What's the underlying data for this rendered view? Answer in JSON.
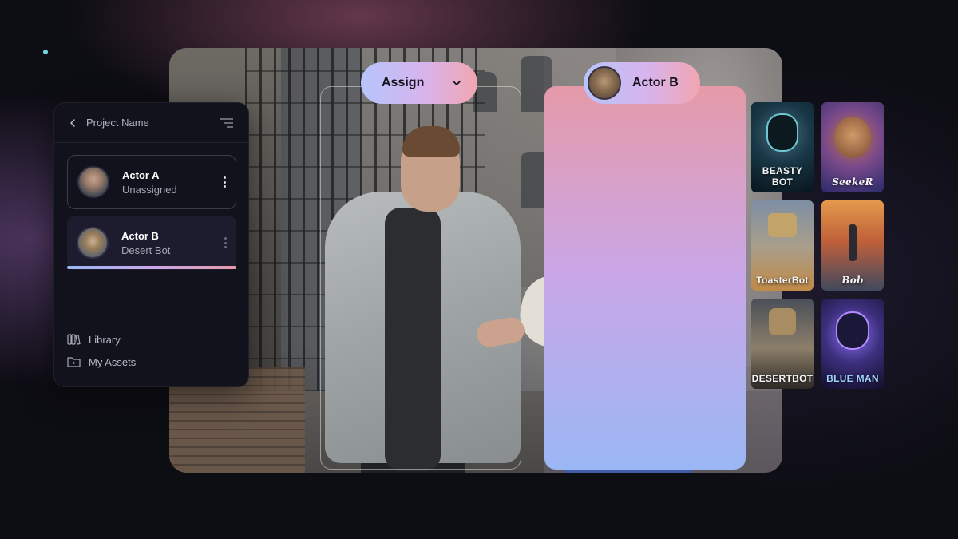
{
  "panel": {
    "project_name": "Project Name",
    "actors": [
      {
        "name": "Actor A",
        "status": "Unassigned"
      },
      {
        "name": "Actor B",
        "status": "Desert Bot"
      }
    ],
    "nav": [
      {
        "label": "Library",
        "icon": "library-icon"
      },
      {
        "label": "My Assets",
        "icon": "folder-play-icon"
      }
    ]
  },
  "video": {
    "assign_label": "Assign",
    "selected_actor_label": "Actor B"
  },
  "characters": [
    {
      "label": "BEASTY BOT"
    },
    {
      "label": "SeekeR"
    },
    {
      "label": "ToasterBot"
    },
    {
      "label": "Bob"
    },
    {
      "label": "DESERTBOT"
    },
    {
      "label": "BLUE MAN"
    }
  ],
  "colors": {
    "background": "#0d0d14",
    "panel": "#12121c",
    "pill_gradient_start": "#b6c5fb",
    "pill_gradient_end": "#f1a6b0",
    "accent_dot": "#6fd8e0"
  }
}
